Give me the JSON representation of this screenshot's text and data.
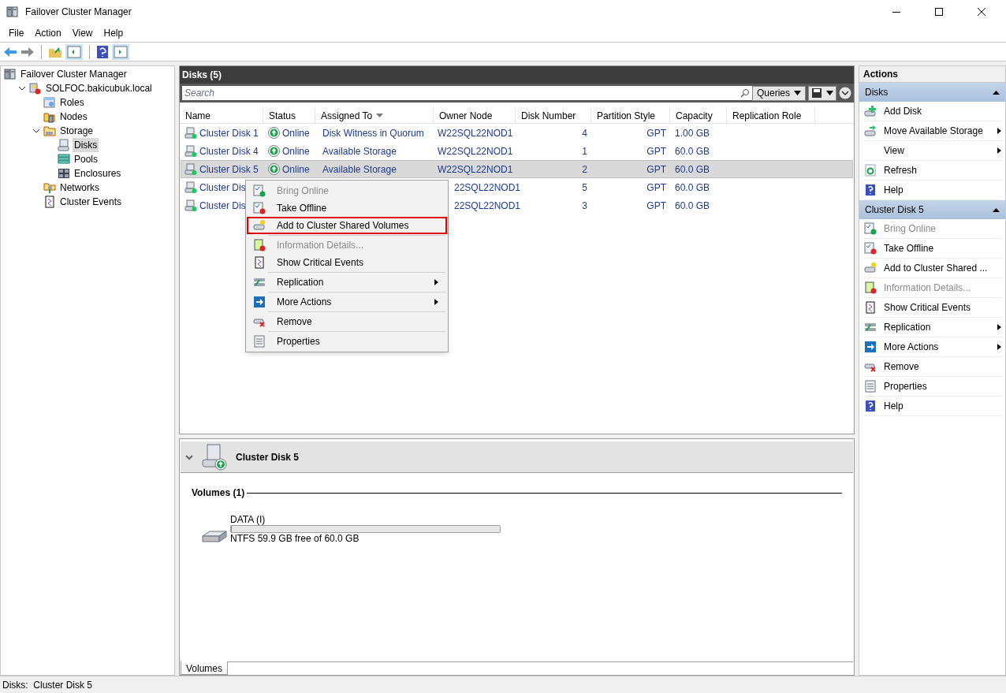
{
  "window": {
    "title": "Failover Cluster Manager"
  },
  "menu_bar": [
    "File",
    "Action",
    "View",
    "Help"
  ],
  "tree": [
    {
      "label": "Failover Cluster Manager",
      "selected": false,
      "children": [
        {
          "label": "SOLFOC.bakicubuk.local",
          "expanded": true,
          "selected": false,
          "children": [
            {
              "label": "Roles",
              "selected": false
            },
            {
              "label": "Nodes",
              "selected": false
            },
            {
              "label": "Storage",
              "expanded": true,
              "selected": false,
              "children": [
                {
                  "label": "Disks",
                  "selected": true
                },
                {
                  "label": "Pools",
                  "selected": false
                },
                {
                  "label": "Enclosures",
                  "selected": false
                }
              ]
            },
            {
              "label": "Networks",
              "selected": false
            },
            {
              "label": "Cluster Events",
              "selected": false
            }
          ]
        }
      ]
    }
  ],
  "center": {
    "title": "Disks (5)",
    "search": {
      "placeholder": "Search"
    },
    "queries_button": "Queries",
    "table": {
      "columns": [
        {
          "label": "Name",
          "sorted": false
        },
        {
          "label": "Status",
          "sorted": false
        },
        {
          "label": "Assigned To",
          "sorted": true
        },
        {
          "label": "Owner Node",
          "sorted": false
        },
        {
          "label": "Disk Number",
          "sorted": false
        },
        {
          "label": "Partition Style",
          "sorted": false
        },
        {
          "label": "Capacity",
          "sorted": false
        },
        {
          "label": "Replication Role",
          "sorted": false
        }
      ],
      "rows": [
        {
          "name": "Cluster Disk 1",
          "status": "Online",
          "assigned_to": "Disk Witness in Quorum",
          "owner_node": "W22SQL22NOD1",
          "disk_number": "4",
          "partition_style": "GPT",
          "capacity": "1.00 GB",
          "selected": false,
          "covered": false
        },
        {
          "name": "Cluster Disk 4",
          "status": "Online",
          "assigned_to": "Available Storage",
          "owner_node": "W22SQL22NOD1",
          "disk_number": "1",
          "partition_style": "GPT",
          "capacity": "60.0 GB",
          "selected": false,
          "covered": false
        },
        {
          "name": "Cluster Disk 5",
          "status": "Online",
          "assigned_to": "Available Storage",
          "owner_node": "W22SQL22NOD1",
          "disk_number": "2",
          "partition_style": "GPT",
          "capacity": "60.0 GB",
          "selected": true,
          "covered": false
        },
        {
          "name": "Cluster Dis",
          "owner_node": "22SQL22NOD1",
          "disk_number": "5",
          "partition_style": "GPT",
          "capacity": "60.0 GB",
          "selected": false,
          "covered": true
        },
        {
          "name": "Cluster Dis",
          "owner_node": "22SQL22NOD1",
          "disk_number": "3",
          "partition_style": "GPT",
          "capacity": "60.0 GB",
          "selected": false,
          "covered": true
        }
      ]
    },
    "context_menu": [
      [
        {
          "label": "Bring Online",
          "disabled": true,
          "highlighted": false,
          "submenu": false
        },
        {
          "label": "Take Offline",
          "disabled": false,
          "highlighted": false,
          "submenu": false
        },
        {
          "label": "Add to Cluster Shared Volumes",
          "disabled": false,
          "highlighted": true,
          "submenu": false
        }
      ],
      [
        {
          "label": "Information Details...",
          "disabled": true,
          "highlighted": false,
          "submenu": false
        },
        {
          "label": "Show Critical Events",
          "disabled": false,
          "highlighted": false,
          "submenu": false
        }
      ],
      [
        {
          "label": "Replication",
          "disabled": false,
          "highlighted": false,
          "submenu": true
        }
      ],
      [
        {
          "label": "More Actions",
          "disabled": false,
          "highlighted": false,
          "submenu": true
        }
      ],
      [
        {
          "label": "Remove",
          "disabled": false,
          "highlighted": false,
          "submenu": false
        }
      ],
      [
        {
          "label": "Properties",
          "disabled": false,
          "highlighted": false,
          "submenu": false
        }
      ]
    ],
    "detail": {
      "title": "Cluster Disk 5",
      "expanded": true,
      "section": "Volumes (1)",
      "volumes": [
        {
          "name": "DATA (I)",
          "level": 0.002,
          "info": "NTFS 59.9 GB free of 60.0 GB"
        }
      ],
      "tabs": [
        {
          "label": "Volumes",
          "selected": true
        }
      ]
    }
  },
  "actions": {
    "title": "Actions",
    "sections": [
      {
        "title": "Disks",
        "expanded": true,
        "items": [
          {
            "label": "Add Disk",
            "disabled": false,
            "submenu": false
          },
          {
            "label": "Move Available Storage",
            "disabled": false,
            "submenu": true
          },
          {
            "label": "View",
            "disabled": false,
            "submenu": true
          },
          {
            "label": "Refresh",
            "disabled": false,
            "submenu": false
          },
          {
            "label": "Help",
            "disabled": false,
            "submenu": false
          }
        ]
      },
      {
        "title": "Cluster Disk 5",
        "expanded": true,
        "items": [
          {
            "label": "Bring Online",
            "disabled": true,
            "submenu": false
          },
          {
            "label": "Take Offline",
            "disabled": false,
            "submenu": false
          },
          {
            "label": "Add to Cluster Shared ...",
            "disabled": false,
            "submenu": false
          },
          {
            "label": "Information Details...",
            "disabled": true,
            "submenu": false
          },
          {
            "label": "Show Critical Events",
            "disabled": false,
            "submenu": false
          },
          {
            "label": "Replication",
            "disabled": false,
            "submenu": true
          },
          {
            "label": "More Actions",
            "disabled": false,
            "submenu": true
          },
          {
            "label": "Remove",
            "disabled": false,
            "submenu": false
          },
          {
            "label": "Properties",
            "disabled": false,
            "submenu": false
          },
          {
            "label": "Help",
            "disabled": false,
            "submenu": false
          }
        ]
      }
    ]
  },
  "status_bar": "Disks:  Cluster Disk 5"
}
